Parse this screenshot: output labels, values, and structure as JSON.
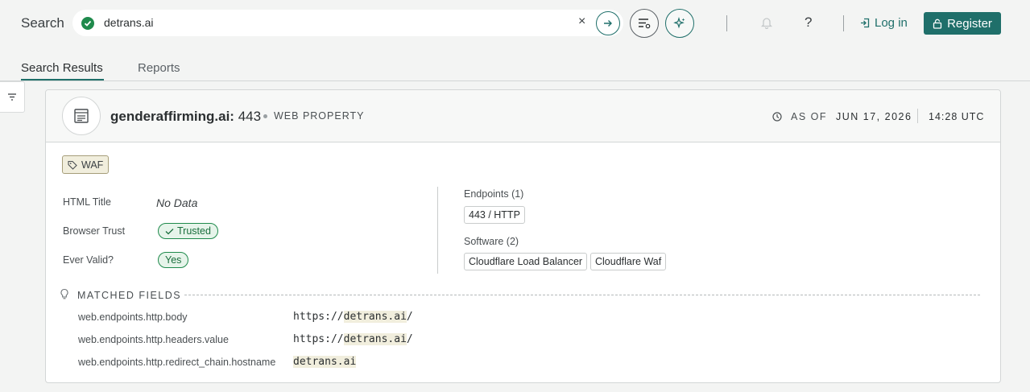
{
  "header": {
    "search_label": "Search",
    "search_value": "detrans.ai",
    "clear_icon": "×",
    "help_icon": "?",
    "login_label": "Log in",
    "register_label": "Register"
  },
  "tabs": [
    {
      "label": "Search Results",
      "active": true
    },
    {
      "label": "Reports",
      "active": false
    }
  ],
  "result": {
    "host": "genderaffirming.ai:",
    "port": "443",
    "type": "WEB PROPERTY",
    "as_of_label": "AS OF",
    "date": "JUN 17, 2026",
    "time": "14:28 UTC",
    "tag": "WAF",
    "fields": {
      "html_title_label": "HTML Title",
      "html_title_value": "No Data",
      "browser_trust_label": "Browser Trust",
      "browser_trust_value": "Trusted",
      "ever_valid_label": "Ever Valid?",
      "ever_valid_value": "Yes"
    },
    "endpoints_label": "Endpoints (1)",
    "endpoints": [
      "443 / HTTP"
    ],
    "software_label": "Software (2)",
    "software": [
      "Cloudflare Load Balancer",
      "Cloudflare Waf"
    ],
    "matched_title": "MATCHED FIELDS",
    "matched": [
      {
        "key": "web.endpoints.http.body",
        "prefix": "https://",
        "hit": "detrans.ai",
        "suffix": "/"
      },
      {
        "key": "web.endpoints.http.headers.value",
        "prefix": "https://",
        "hit": "detrans.ai",
        "suffix": "/"
      },
      {
        "key": "web.endpoints.http.redirect_chain.hostname",
        "prefix": "",
        "hit": "detrans.ai",
        "suffix": ""
      }
    ]
  },
  "colors": {
    "accent": "#1f6f6a",
    "success": "#1f8a4c",
    "highlight": "#f1eedd"
  }
}
